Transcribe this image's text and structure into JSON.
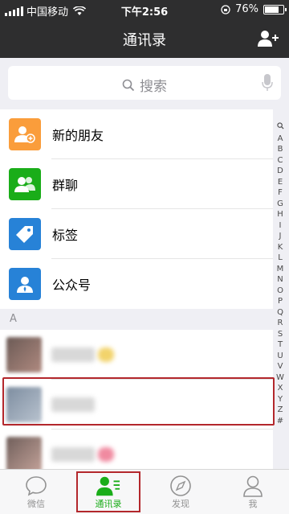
{
  "status": {
    "carrier": "中国移动",
    "time": "下午2:56",
    "battery": "76%",
    "battery_level": 0.76
  },
  "nav": {
    "title": "通讯录"
  },
  "search": {
    "placeholder": "搜索"
  },
  "menu": [
    {
      "label": "新的朋友",
      "icon": "new-friend-icon",
      "color": "#fa9d3b"
    },
    {
      "label": "群聊",
      "icon": "group-chat-icon",
      "color": "#1aad19"
    },
    {
      "label": "标签",
      "icon": "tag-icon",
      "color": "#2782d7"
    },
    {
      "label": "公众号",
      "icon": "official-account-icon",
      "color": "#2782d7"
    }
  ],
  "section": {
    "letter": "A"
  },
  "index": [
    "Q",
    "A",
    "B",
    "C",
    "D",
    "E",
    "F",
    "G",
    "H",
    "I",
    "J",
    "K",
    "L",
    "M",
    "N",
    "O",
    "P",
    "Q",
    "R",
    "S",
    "T",
    "U",
    "V",
    "W",
    "X",
    "Y",
    "Z",
    "#"
  ],
  "tabs": [
    {
      "label": "微信",
      "icon": "chat-bubble-icon"
    },
    {
      "label": "通讯录",
      "icon": "contacts-icon",
      "active": true
    },
    {
      "label": "发现",
      "icon": "compass-icon"
    },
    {
      "label": "我",
      "icon": "person-icon"
    }
  ],
  "colors": {
    "bar": "#2e2e2f",
    "accent": "#1aad19",
    "highlight": "#b3272c"
  }
}
